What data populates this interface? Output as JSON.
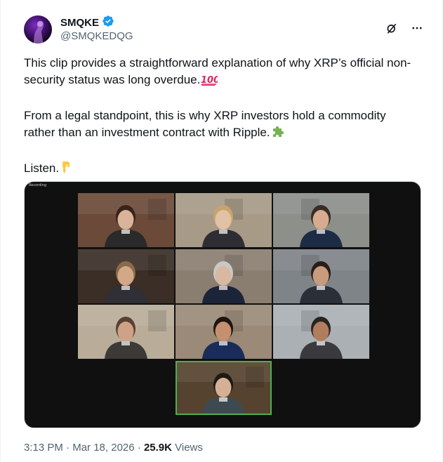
{
  "author": {
    "display_name": "SMQKE",
    "handle": "@SMQKEDQG",
    "verified": true,
    "verified_color": "#1d9bf0",
    "avatar_icon": "avatar-purple-silhouette"
  },
  "actions": {
    "grok_icon": "grok-icon",
    "more_icon": "more-icon"
  },
  "tweet": {
    "paragraph_1": "This clip provides a straightforward explanation of why XRP’s official non-security status was long overdue.",
    "paragraph_1_emoji": "hundred-points-emoji",
    "paragraph_2": "From a legal standpoint, this is why XRP investors hold a commodity rather than an investment contract with Ripple.",
    "paragraph_2_emoji": "puzzle-piece-emoji",
    "paragraph_3": "Listen.",
    "paragraph_3_emoji": "backhand-index-pointing-down-emoji"
  },
  "media": {
    "recording_label": "Recording",
    "tiles": [
      {
        "name": "participant-1",
        "bg": "#6b4a3a",
        "face": "#d9b39a",
        "hair": "#3a2418",
        "shirt": "#2a2a2a"
      },
      {
        "name": "participant-2",
        "bg": "#a79a86",
        "face": "#e2c2a6",
        "hair": "#c9a36e",
        "shirt": "#2d2d33"
      },
      {
        "name": "participant-3",
        "bg": "#8d8f8b",
        "face": "#d6ab8f",
        "hair": "#3a2c24",
        "shirt": "#1e2b44"
      },
      {
        "name": "participant-4",
        "bg": "#3a2e26",
        "face": "#d2a888",
        "hair": "#8a6a4a",
        "shirt": "#2f2f35"
      },
      {
        "name": "participant-5",
        "bg": "#8a7e70",
        "face": "#d8b8a0",
        "hair": "#c8c8c8",
        "shirt": "#1c2438"
      },
      {
        "name": "participant-6",
        "bg": "#7f8488",
        "face": "#c89a7e",
        "hair": "#2a1e18",
        "shirt": "#2b2f3a"
      },
      {
        "name": "participant-7",
        "bg": "#b9ad9a",
        "face": "#cfa287",
        "hair": "#5a4030",
        "shirt": "#3b3a36"
      },
      {
        "name": "participant-8",
        "bg": "#9b8a78",
        "face": "#c4906e",
        "hair": "#1e1410",
        "shirt": "#1a2d5a"
      },
      {
        "name": "participant-9",
        "bg": "#aab0b4",
        "face": "#b07d5e",
        "hair": "#2a2420",
        "shirt": "#3a3a3e"
      },
      {
        "name": "participant-10",
        "bg": "#55432f",
        "face": "#d6b095",
        "hair": "#1e1a16",
        "shirt": "#3e4a52"
      }
    ]
  },
  "meta": {
    "time": "3:13 PM",
    "separator_1": " · ",
    "date": "Mar 18, 2026",
    "separator_2": " · ",
    "views_count": "25.9K",
    "views_label": " Views"
  }
}
